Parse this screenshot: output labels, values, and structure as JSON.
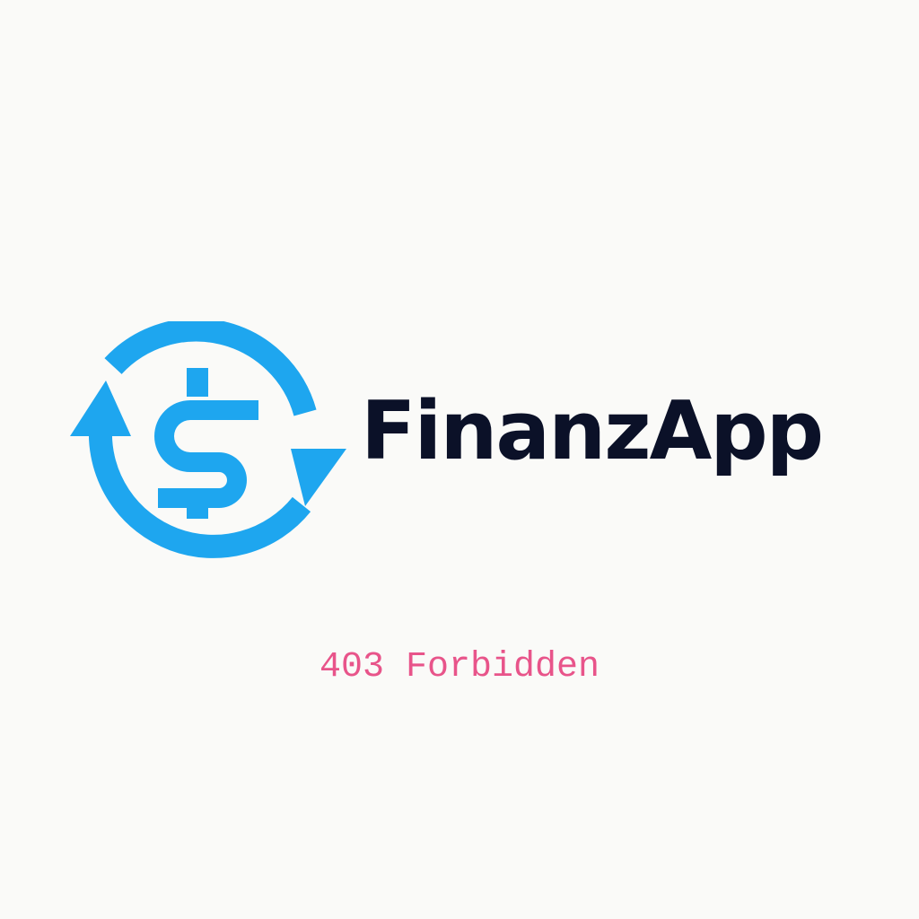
{
  "logo": {
    "icon": "currency-exchange-icon",
    "wordmark": "FinanzApp"
  },
  "error": {
    "message": "403 Forbidden"
  },
  "colors": {
    "background": "#fafaf8",
    "accent": "#1ea6ef",
    "wordmark": "#0b1128",
    "error": "#e8548a"
  }
}
